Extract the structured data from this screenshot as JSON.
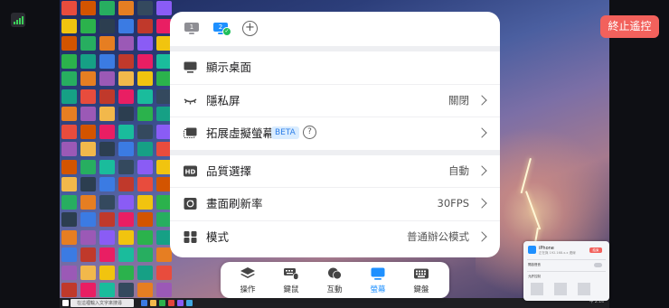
{
  "window": {
    "stop_button_label": "終止遙控",
    "signal_icon": "signal-bars-icon",
    "accent_color": "#f2615c"
  },
  "remote_desktop": {
    "search_placeholder": "在這裡輸入文字來搜尋",
    "tray_text": "中 2:14"
  },
  "screens": {
    "items": [
      {
        "number": "1",
        "active": false,
        "connected": false
      },
      {
        "number": "2",
        "active": true,
        "connected": true
      }
    ],
    "add_icon": "plus-circle-icon"
  },
  "menu": {
    "group1": [
      {
        "label": "顯示桌面",
        "icon": "monitor-icon",
        "value": ""
      },
      {
        "label": "隱私屏",
        "icon": "eye-closed-icon",
        "value": "關閉"
      },
      {
        "label": "拓展虛擬螢幕",
        "icon": "extend-screen-icon",
        "value": "",
        "badge": "BETA",
        "help": "?"
      }
    ],
    "group2": [
      {
        "label": "品質選擇",
        "icon": "hd-icon",
        "value": "自動"
      },
      {
        "label": "畫面刷新率",
        "icon": "refresh-icon",
        "value": "30FPS"
      },
      {
        "label": "模式",
        "icon": "grid-icon",
        "value": "普通辦公模式"
      }
    ]
  },
  "dock": {
    "items": [
      {
        "label": "操作",
        "icon": "layers-icon",
        "active": false
      },
      {
        "label": "鍵鼠",
        "icon": "keyboard-mouse-icon",
        "active": false
      },
      {
        "label": "互動",
        "icon": "chat-icon",
        "active": false
      },
      {
        "label": "螢幕",
        "icon": "screen-icon",
        "active": true
      },
      {
        "label": "鍵盤",
        "icon": "keyboard-icon",
        "active": false
      }
    ],
    "active_color": "#1e90ff"
  },
  "mini_window": {
    "title": "iPhone",
    "subtitle": "正在與 192.168.x.x 連線",
    "stop_label": "結束",
    "row1": "開啟聲音",
    "row2": "允許控制"
  }
}
